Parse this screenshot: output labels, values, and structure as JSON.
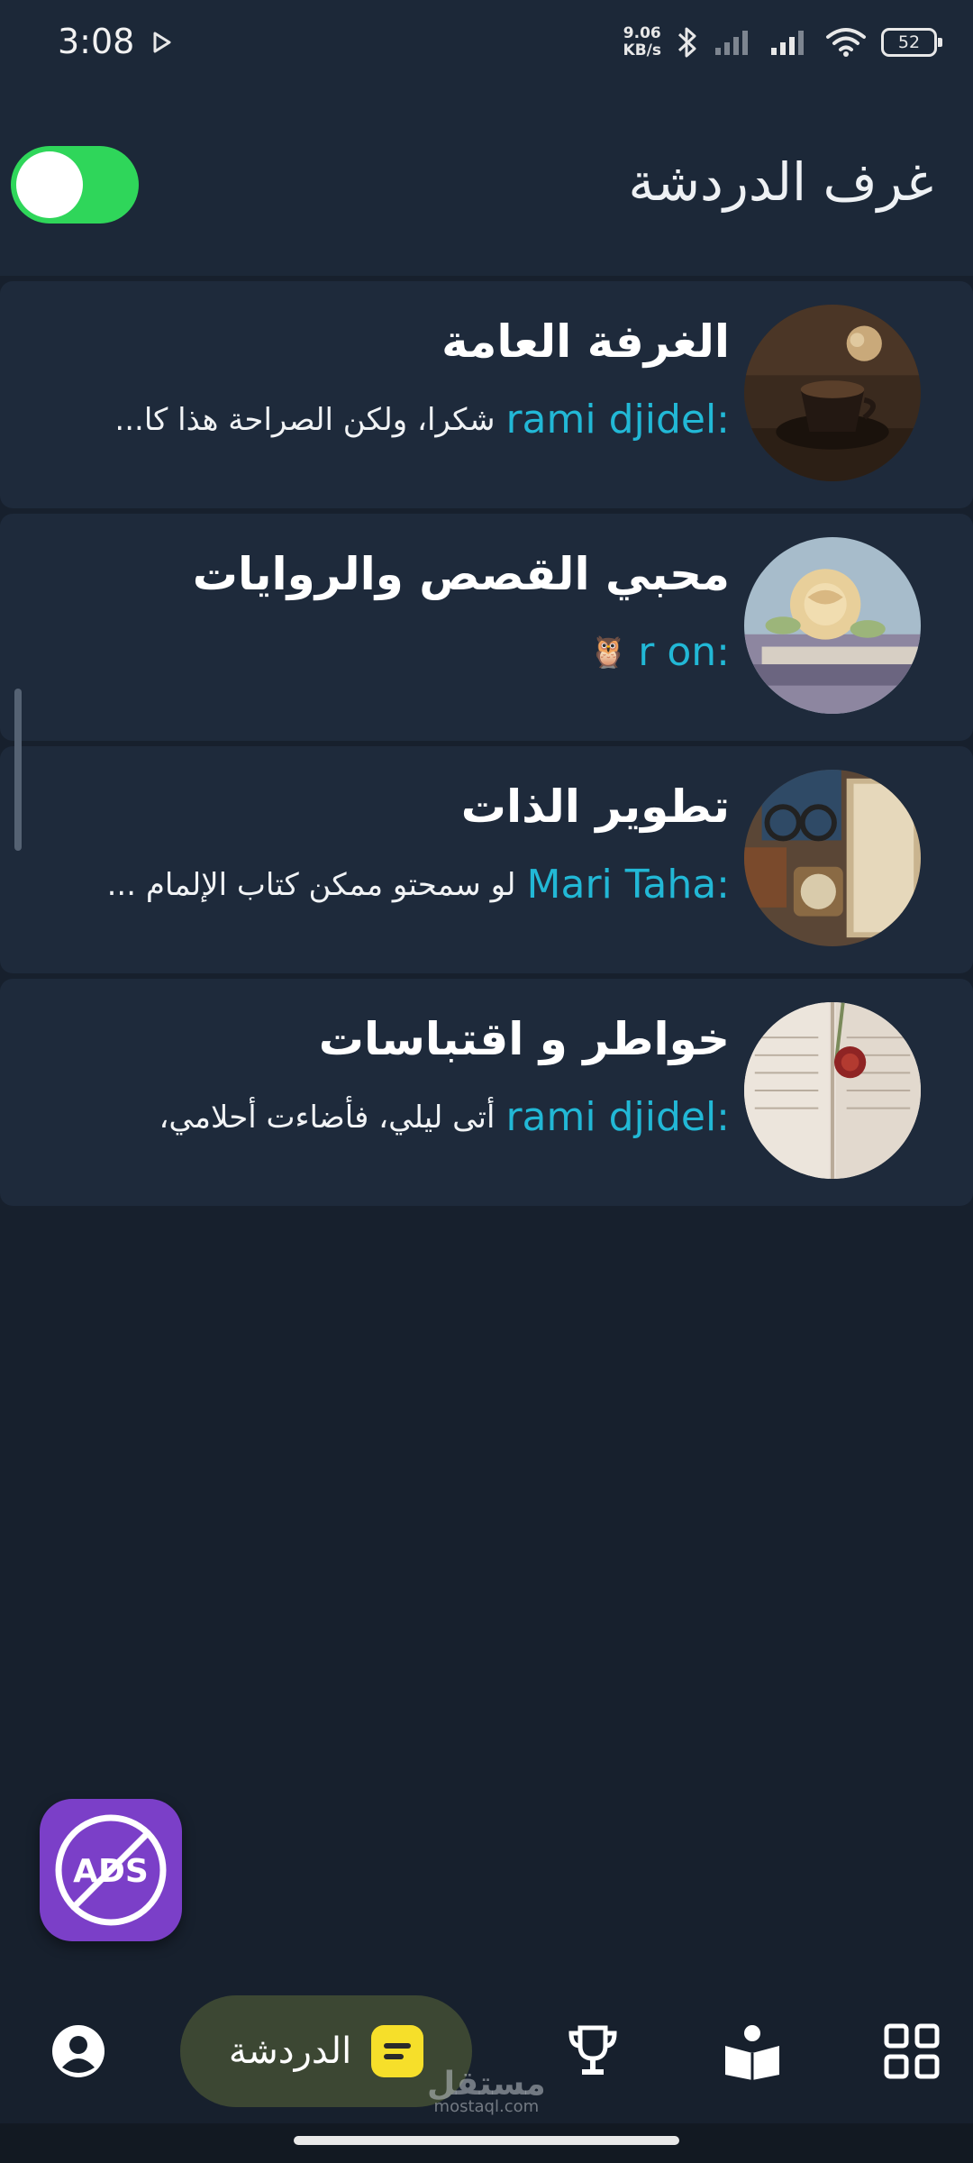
{
  "status_bar": {
    "time": "3:08",
    "speed_value": "9.06",
    "speed_unit": "KB/s",
    "battery": "52"
  },
  "header": {
    "title": "غرف الدردشة",
    "toggle_on": true
  },
  "rooms": [
    {
      "name": "الغرفة العامة",
      "sender": "rami djidel:",
      "message": "شكرا، ولكن الصراحة هذا كا..."
    },
    {
      "name": "محبي القصص والروايات",
      "sender": "r on:",
      "message": "🦉"
    },
    {
      "name": "تطوير الذات",
      "sender": "Mari Taha:",
      "message": "لو سمحتو ممكن كتاب الإلمام ..."
    },
    {
      "name": "خواطر و اقتباسات",
      "sender": "rami djidel:",
      "message": "أتى ليلي، فأضاءت أحلامي،"
    }
  ],
  "ads_button": {
    "label": "ADS"
  },
  "bottom_nav": {
    "chat_label": "الدردشة"
  },
  "watermark": {
    "arabic": "مستقل",
    "latin": "mostaql.com"
  },
  "colors": {
    "background": "#17202d",
    "card": "#1e2a3b",
    "sender": "#22b8d6",
    "toggle": "#2fd65a",
    "ads": "#7b3fc8",
    "chat_pill": "#3c4733",
    "chat_icon": "#f6df2a"
  },
  "icons": [
    "play-icon",
    "bluetooth-icon",
    "signal-icon",
    "wifi-icon",
    "battery-icon",
    "profile-icon",
    "chat-icon",
    "trophy-icon",
    "reading-icon",
    "grid-icon",
    "no-ads-icon"
  ]
}
